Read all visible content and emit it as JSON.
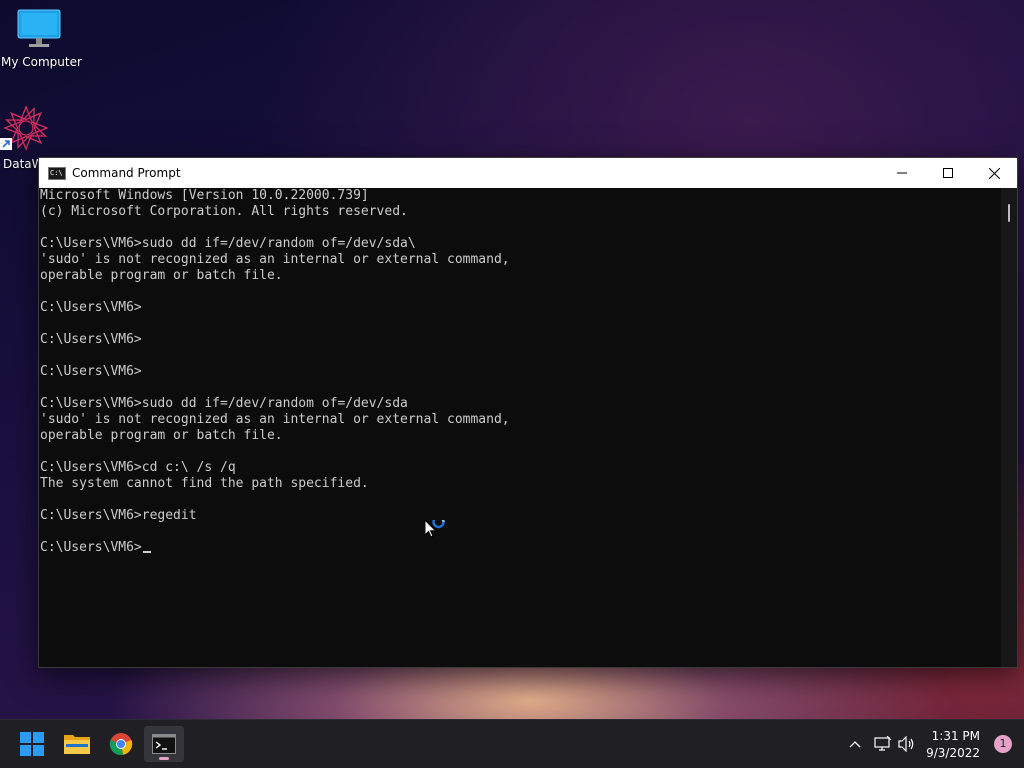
{
  "desktop": {
    "icons": [
      {
        "label": "My Computer"
      },
      {
        "label": "DataW"
      }
    ]
  },
  "window": {
    "title": "Command Prompt",
    "app_icon_text": "C:\\",
    "buttons": {
      "minimize": "minimize",
      "maximize": "maximize",
      "close": "close"
    }
  },
  "console": {
    "lines": [
      "Microsoft Windows [Version 10.0.22000.739]",
      "(c) Microsoft Corporation. All rights reserved.",
      "",
      "C:\\Users\\VM6>sudo dd if=/dev/random of=/dev/sda\\",
      "'sudo' is not recognized as an internal or external command,",
      "operable program or batch file.",
      "",
      "C:\\Users\\VM6>",
      "",
      "C:\\Users\\VM6>",
      "",
      "C:\\Users\\VM6>",
      "",
      "C:\\Users\\VM6>sudo dd if=/dev/random of=/dev/sda",
      "'sudo' is not recognized as an internal or external command,",
      "operable program or batch file.",
      "",
      "C:\\Users\\VM6>cd c:\\ /s /q",
      "The system cannot find the path specified.",
      "",
      "C:\\Users\\VM6>regedit",
      ""
    ],
    "prompt": "C:\\Users\\VM6>"
  },
  "taskbar": {
    "items": [
      {
        "name": "start-button",
        "icon": "windows-logo-icon"
      },
      {
        "name": "file-explorer",
        "icon": "folder-icon"
      },
      {
        "name": "chrome",
        "icon": "chrome-icon"
      },
      {
        "name": "command-prompt",
        "icon": "terminal-icon",
        "active": true
      }
    ],
    "tray": {
      "time": "1:31 PM",
      "date": "9/3/2022",
      "notification_count": "1"
    }
  },
  "colors": {
    "console_bg": "#0c0c0c",
    "console_fg": "#cccccc",
    "taskbar_bg": "#1f1f24",
    "accent": "#e6a2c9"
  }
}
